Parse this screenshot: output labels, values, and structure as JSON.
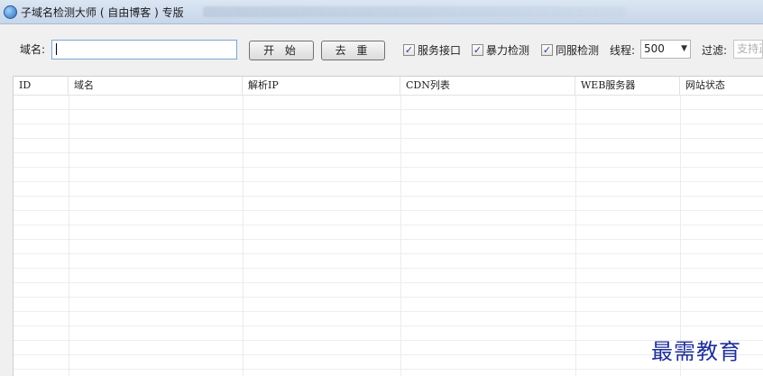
{
  "window": {
    "title": "子域名检测大师 ( 自由博客 ) 专版"
  },
  "toolbar": {
    "domain_label": "域名:",
    "domain_value": "",
    "start_button": "开 始",
    "dedupe_button": "去 重",
    "options": [
      {
        "label": "服务接口",
        "checked": true
      },
      {
        "label": "暴力检测",
        "checked": true
      },
      {
        "label": "同服检测",
        "checked": true
      }
    ],
    "threads_label": "线程:",
    "threads_value": "500",
    "filter_label": "过滤:",
    "filter_placeholder": "支持正"
  },
  "table": {
    "columns": [
      "ID",
      "域名",
      "解析IP",
      "CDN列表",
      "WEB服务器",
      "网站状态"
    ]
  },
  "watermark": "最需教育"
}
